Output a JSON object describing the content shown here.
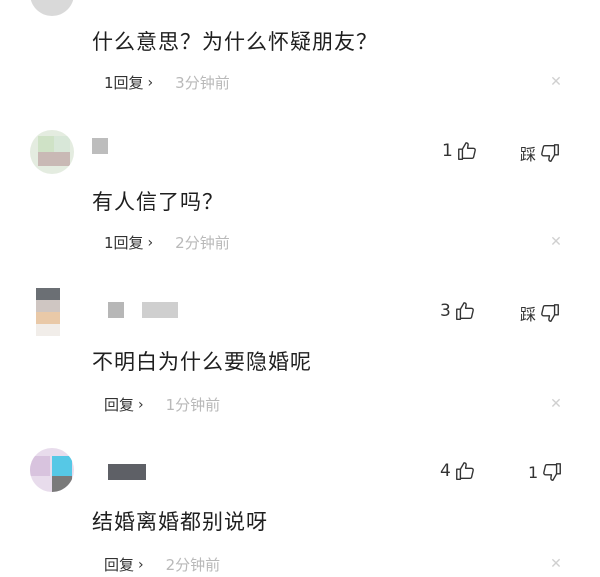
{
  "comments": [
    {
      "text": "什么意思？为什么怀疑朋友？",
      "reply_label": "1回复",
      "time": "3分钟前"
    },
    {
      "text": "有人信了吗？",
      "likes": "1",
      "dislike_label": "踩",
      "reply_label": "1回复",
      "time": "2分钟前"
    },
    {
      "text": "不明白为什么要隐婚呢",
      "likes": "3",
      "dislike_label": "踩",
      "reply_label": "回复",
      "time": "1分钟前"
    },
    {
      "text": "结婚离婚都别说呀",
      "likes": "4",
      "dislikes": "1",
      "reply_label": "回复",
      "time": "2分钟前"
    }
  ],
  "icons": {
    "like": "thumbs-up-icon",
    "dislike": "thumbs-down-icon",
    "chevron": "chevron-right-icon",
    "close": "close-icon"
  },
  "colors": {
    "time_gray": "#b9b9b9",
    "text_dark": "#1f1f1f",
    "close_gray": "#d0d0d0"
  }
}
